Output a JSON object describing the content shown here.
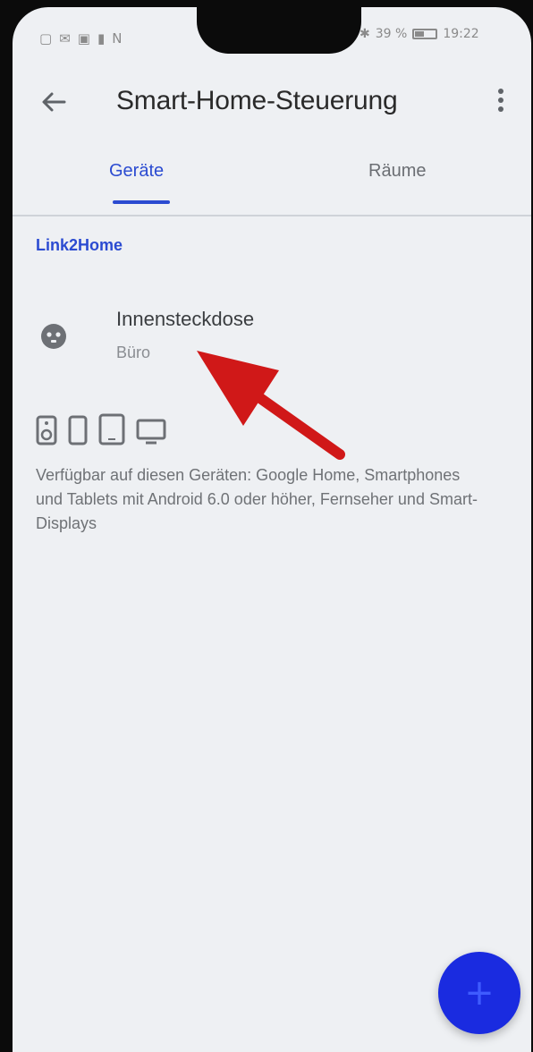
{
  "status_bar": {
    "left_icons": [
      "sim-icon",
      "mail-icon",
      "cast-icon",
      "lock-icon",
      "nfc-icon"
    ],
    "bluetooth": "✱",
    "battery_text": "39 %",
    "battery_level": 0.39,
    "time": "19:22"
  },
  "app_bar": {
    "title": "Smart-Home-Steuerung",
    "back_icon": "arrow-back-icon",
    "menu_icon": "more-vertical-icon"
  },
  "tabs": [
    {
      "label": "Geräte",
      "selected": true
    },
    {
      "label": "Räume",
      "selected": false
    }
  ],
  "section": {
    "title": "Link2Home"
  },
  "device": {
    "name": "Innensteckdose",
    "room": "Büro",
    "icon": "power-socket-icon"
  },
  "availability": {
    "device_icons": [
      "speaker-icon",
      "smartphone-icon",
      "tablet-icon",
      "tv-icon"
    ],
    "text": "Verfügbar auf diesen Geräten: Google Home, Smartphones und Tablets mit Android 6.0 oder höher, Fernseher und Smart-Displays"
  },
  "fab": {
    "label": "+",
    "icon": "add-icon"
  },
  "colors": {
    "accent": "#2b4bd1",
    "fab": "#1a2be0",
    "annotation_arrow": "#d01818",
    "background": "#eef0f3"
  }
}
